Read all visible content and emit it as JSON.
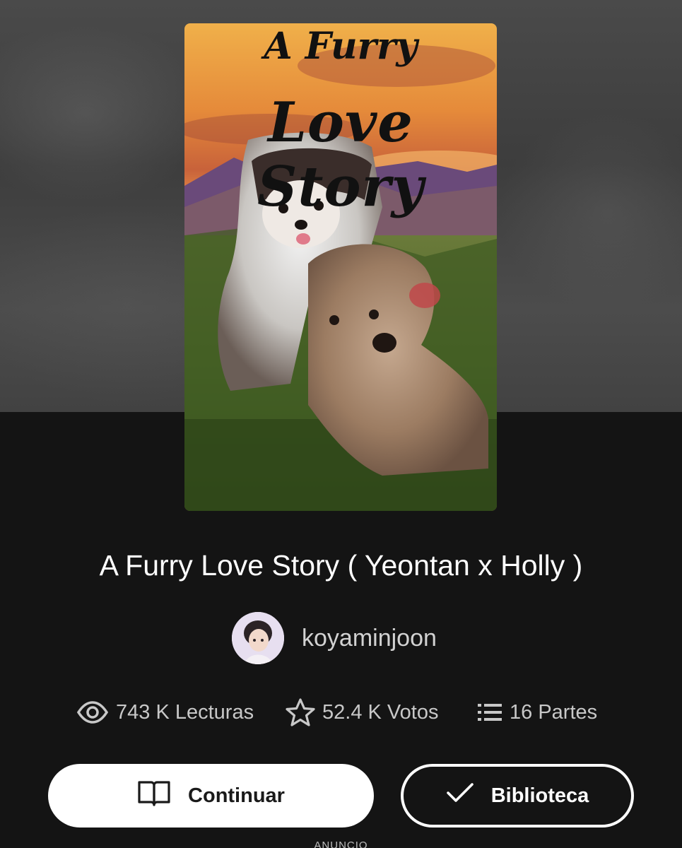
{
  "cover": {
    "title_top": "A Furry",
    "title_main": "Love Story"
  },
  "story": {
    "title": "A Furry Love Story ( Yeontan x Holly )"
  },
  "author": {
    "name": "koyaminjoon"
  },
  "stats": {
    "reads": "743 K Lecturas",
    "votes": "52.4 K Votos",
    "parts": "16 Partes",
    "icons": [
      "eye-icon",
      "star-icon",
      "list-icon"
    ]
  },
  "actions": {
    "continue_label": "Continuar",
    "library_label": "Biblioteca"
  },
  "ad": {
    "label": "ANUNCIO"
  },
  "colors": {
    "background": "#141414",
    "button_primary": "#ffffff",
    "text_primary": "#ffffff",
    "text_secondary": "#c8c8c8"
  }
}
